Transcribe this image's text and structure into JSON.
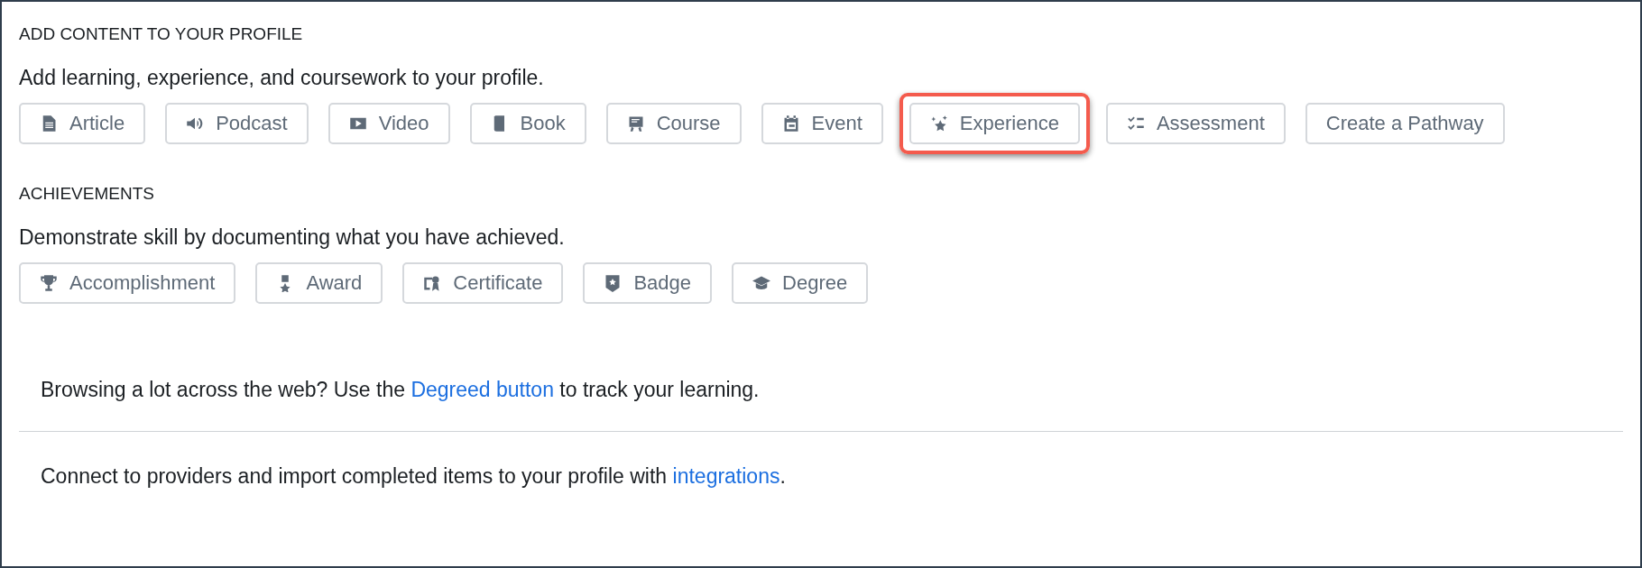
{
  "sections": [
    {
      "heading": "ADD CONTENT TO YOUR PROFILE",
      "description": "Add learning, experience, and coursework to your profile.",
      "buttons": [
        {
          "label": "Article",
          "kind": "article",
          "highlighted": false
        },
        {
          "label": "Podcast",
          "kind": "podcast",
          "highlighted": false
        },
        {
          "label": "Video",
          "kind": "video",
          "highlighted": false
        },
        {
          "label": "Book",
          "kind": "book",
          "highlighted": false
        },
        {
          "label": "Course",
          "kind": "course",
          "highlighted": false
        },
        {
          "label": "Event",
          "kind": "event",
          "highlighted": false
        },
        {
          "label": "Experience",
          "kind": "experience",
          "highlighted": true
        },
        {
          "label": "Assessment",
          "kind": "assessment",
          "highlighted": false
        },
        {
          "label": "Create a Pathway",
          "kind": "pathway",
          "highlighted": false
        }
      ]
    },
    {
      "heading": "ACHIEVEMENTS",
      "description": "Demonstrate skill by documenting what you have achieved.",
      "buttons": [
        {
          "label": "Accomplishment",
          "kind": "accomplishment",
          "highlighted": false
        },
        {
          "label": "Award",
          "kind": "award",
          "highlighted": false
        },
        {
          "label": "Certificate",
          "kind": "certificate",
          "highlighted": false
        },
        {
          "label": "Badge",
          "kind": "badge",
          "highlighted": false
        },
        {
          "label": "Degree",
          "kind": "degree",
          "highlighted": false
        }
      ]
    }
  ],
  "footer_notes": [
    {
      "before": "Browsing a lot across the web? Use the ",
      "link": "Degreed button",
      "after": " to track your learning."
    },
    {
      "before": "Connect to providers and import completed items to your profile with ",
      "link": "integrations",
      "after": "."
    }
  ]
}
